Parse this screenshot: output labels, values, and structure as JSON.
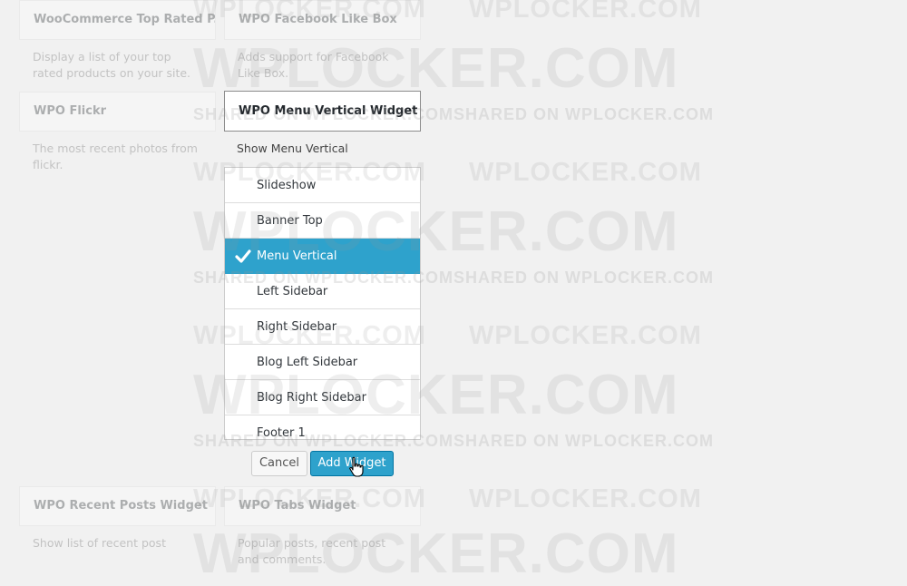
{
  "background_widgets": [
    {
      "title": "WooCommerce Top Rated P...",
      "description": "Display a list of your top rated products on your site."
    },
    {
      "title": "WPO Facebook Like Box",
      "description": "Adds support for Facebook Like Box."
    },
    {
      "title": "WPO Flickr",
      "description": "The most recent photos from flickr."
    },
    {
      "title": "WPO Recent Posts Widget",
      "description": "Show list of recent post"
    },
    {
      "title": "WPO Tabs Widget",
      "description": "Popular posts, recent post and comments."
    }
  ],
  "chooser": {
    "title": "WPO Menu Vertical Widget",
    "description": "Show Menu Vertical",
    "selected_index": 2,
    "sidebars": [
      "Slideshow",
      "Banner Top",
      "Menu Vertical",
      "Left Sidebar",
      "Right Sidebar",
      "Blog Left Sidebar",
      "Blog Right Sidebar",
      "Footer 1"
    ],
    "cancel_label": "Cancel",
    "add_label": "Add Widget"
  },
  "watermark": {
    "large_text": "WPLOCKER.COM",
    "small_text": "SHARED ON WPLOCKER.COM"
  },
  "colors": {
    "accent": "#2ea2cc",
    "accent_border": "#0074a2",
    "background": "#f1f1f1"
  },
  "icons": {
    "selected_mark": "check-icon",
    "pointer": "hand-pointer-icon"
  }
}
